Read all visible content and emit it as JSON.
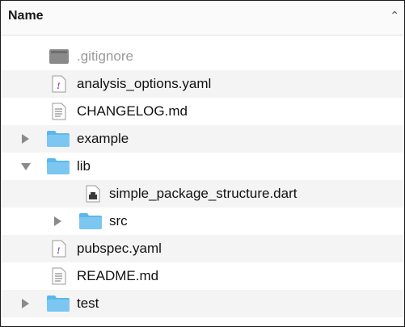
{
  "header": {
    "column_label": "Name",
    "sort_icon": "chevron-up-icon"
  },
  "colors": {
    "folder": "#5bb7ec",
    "folder_tab": "#7cc7f2",
    "yaml_accent": "#8e44ad",
    "dim_text": "#9a9a9a"
  },
  "rows": [
    {
      "label": ".gitignore",
      "icon": "hidden-file-icon",
      "disclosure": "none",
      "dimmed": true
    },
    {
      "label": "analysis_options.yaml",
      "icon": "yaml-file-icon",
      "disclosure": "none"
    },
    {
      "label": "CHANGELOG.md",
      "icon": "text-file-icon",
      "disclosure": "none"
    },
    {
      "label": "example",
      "icon": "folder-icon",
      "disclosure": "collapsed"
    },
    {
      "label": "lib",
      "icon": "folder-icon",
      "disclosure": "expanded"
    },
    {
      "label": "simple_package_structure.dart",
      "icon": "dart-file-icon",
      "disclosure": "none"
    },
    {
      "label": "src",
      "icon": "folder-icon",
      "disclosure": "collapsed"
    },
    {
      "label": "pubspec.yaml",
      "icon": "yaml-file-icon",
      "disclosure": "none"
    },
    {
      "label": "README.md",
      "icon": "text-file-icon",
      "disclosure": "none"
    },
    {
      "label": "test",
      "icon": "folder-icon",
      "disclosure": "collapsed"
    }
  ]
}
